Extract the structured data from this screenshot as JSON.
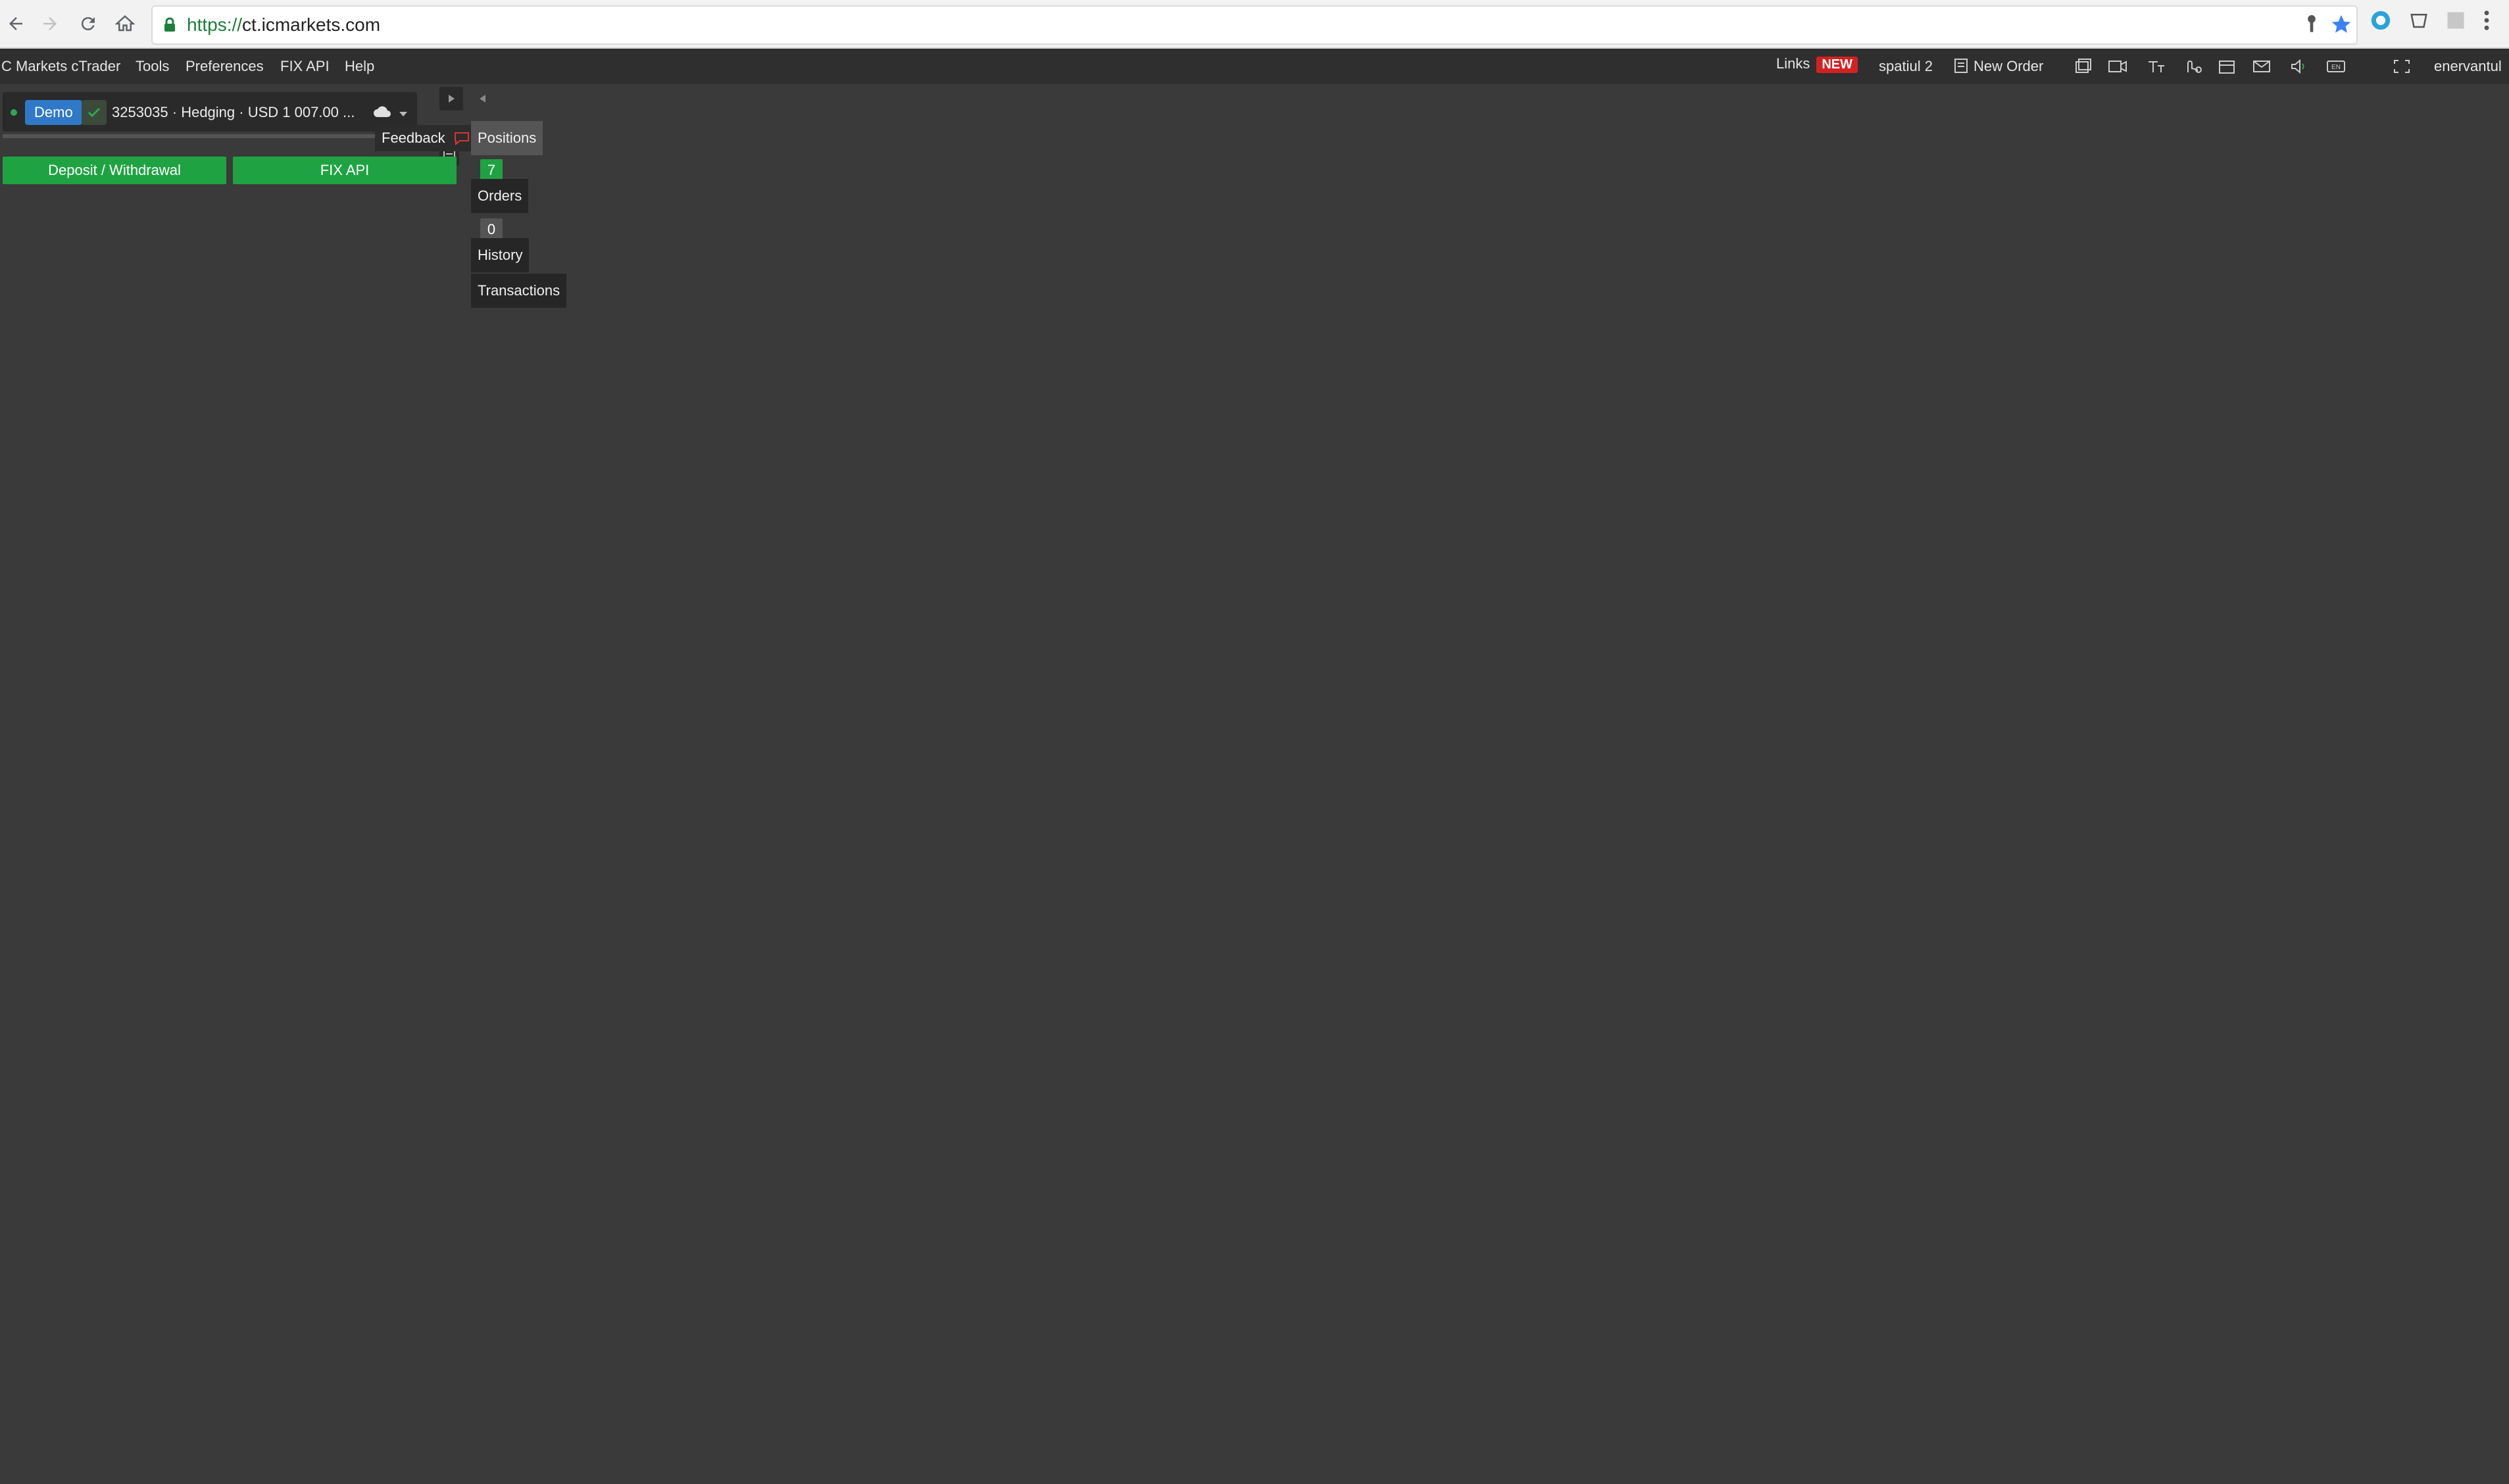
{
  "browser": {
    "url_scheme": "https://",
    "url_host": "ct.icmarkets.com",
    "icons": [
      "back-arrow-icon",
      "forward-arrow-icon",
      "reload-icon",
      "home-icon",
      "lock-icon",
      "key-icon",
      "star-icon",
      "extension-icon",
      "menu-dots-icon"
    ]
  },
  "menubar": {
    "app_title": "C Markets cTrader",
    "items": [
      "Tools",
      "Preferences",
      "FIX API",
      "Help"
    ],
    "links_label": "Links",
    "new_badge": "NEW",
    "workspace": "spatiul 2",
    "new_order": "New Order",
    "username": "enervantul"
  },
  "account": {
    "demo_label": "Demo",
    "info": "3253035 · Hedging · USD 1 007.00 ..."
  },
  "panel": {
    "feedback_label": "Feedback",
    "deposit_button": "Deposit / Withdrawal",
    "fix_api_button": "FIX API"
  },
  "tabs": {
    "positions_label": "Positions",
    "positions_count": "7",
    "orders_label": "Orders",
    "orders_count": "0",
    "history_label": "History",
    "transactions_label": "Transactions"
  },
  "colors": {
    "background": "#3a3a3a",
    "accent_green": "#1fa342",
    "demo_blue": "#2f79c8",
    "new_red": "#d32222"
  }
}
